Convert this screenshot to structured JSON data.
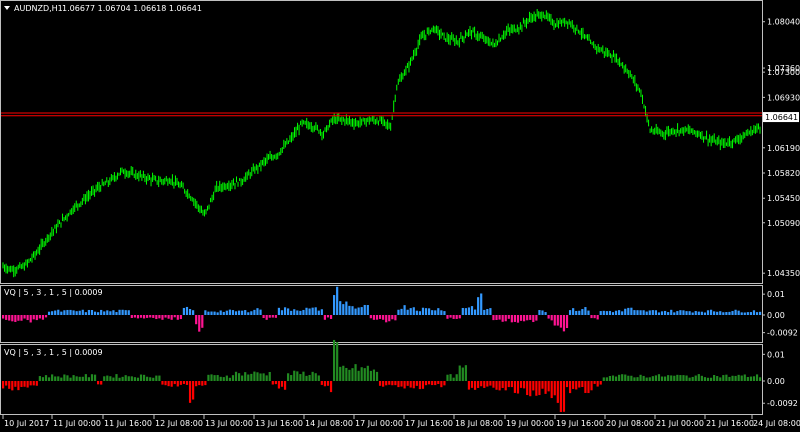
{
  "header": {
    "symbol_label": "AUDNZD,H1",
    "ohlc_text": "1.06677 1.06704 1.06618 1.06641"
  },
  "panels": {
    "indicator_1_label": "VQ | 5 , 3 , 1 , 5  |  0.0009",
    "indicator_2_label": "VQ | 5 , 3 , 1 , 5  |  0.0009"
  },
  "colors": {
    "bars": "#00ff00",
    "hline": "#ff0000",
    "ind1_up": "#3399ff",
    "ind1_down": "#ff1493",
    "ind2_up": "#228b22",
    "ind2_down": "#ff0000",
    "border": "#c0c0c0"
  },
  "chart_data": [
    {
      "type": "ohlc",
      "price_axis_ticks": [
        "1.08040",
        "1.07360",
        "1.07300",
        "1.06930",
        "1.06641",
        "1.06190",
        "1.05820",
        "1.05450",
        "1.05090",
        "1.04350"
      ],
      "ylim": [
        1.0425,
        1.083
      ],
      "current_price": 1.06641,
      "horizontal_lines": [
        1.067,
        1.0666
      ],
      "x_ticks": [
        "10 Jul 2017",
        "11 Jul 00:00",
        "11 Jul 16:00",
        "12 Jul 08:00",
        "13 Jul 00:00",
        "13 Jul 16:00",
        "14 Jul 08:00",
        "17 Jul 00:00",
        "17 Jul 16:00",
        "18 Jul 08:00",
        "19 Jul 00:00",
        "19 Jul 16:00",
        "20 Jul 08:00",
        "21 Jul 00:00",
        "21 Jul 16:00",
        "24 Jul 08:00"
      ],
      "close_path": [
        [
          0,
          1.0445
        ],
        [
          6,
          1.044
        ],
        [
          14,
          1.0445
        ],
        [
          22,
          1.0465
        ],
        [
          30,
          1.049
        ],
        [
          38,
          1.051
        ],
        [
          46,
          1.053
        ],
        [
          54,
          1.0545
        ],
        [
          62,
          1.056
        ],
        [
          70,
          1.057
        ],
        [
          78,
          1.0585
        ],
        [
          86,
          1.058
        ],
        [
          94,
          1.0575
        ],
        [
          102,
          1.057
        ],
        [
          110,
          1.0572
        ],
        [
          118,
          1.056
        ],
        [
          124,
          1.0545
        ],
        [
          132,
          1.052
        ],
        [
          140,
          1.056
        ],
        [
          148,
          1.0565
        ],
        [
          156,
          1.057
        ],
        [
          164,
          1.0585
        ],
        [
          172,
          1.06
        ],
        [
          180,
          1.061
        ],
        [
          188,
          1.063
        ],
        [
          196,
          1.0655
        ],
        [
          204,
          1.065
        ],
        [
          210,
          1.064
        ],
        [
          216,
          1.066
        ],
        [
          224,
          1.066
        ],
        [
          232,
          1.0655
        ],
        [
          240,
          1.066
        ],
        [
          248,
          1.0658
        ],
        [
          254,
          1.065
        ],
        [
          258,
          1.071
        ],
        [
          266,
          1.074
        ],
        [
          274,
          1.078
        ],
        [
          282,
          1.0795
        ],
        [
          290,
          1.078
        ],
        [
          298,
          1.0775
        ],
        [
          306,
          1.079
        ],
        [
          314,
          1.078
        ],
        [
          322,
          1.077
        ],
        [
          330,
          1.079
        ],
        [
          338,
          1.0795
        ],
        [
          346,
          1.081
        ],
        [
          354,
          1.0815
        ],
        [
          362,
          1.08
        ],
        [
          370,
          1.0805
        ],
        [
          378,
          1.079
        ],
        [
          386,
          1.077
        ],
        [
          394,
          1.076
        ],
        [
          402,
          1.075
        ],
        [
          410,
          1.073
        ],
        [
          418,
          1.07
        ],
        [
          424,
          1.0645
        ],
        [
          432,
          1.064
        ],
        [
          440,
          1.0645
        ],
        [
          448,
          1.0645
        ],
        [
          456,
          1.064
        ],
        [
          464,
          1.063
        ],
        [
          472,
          1.0625
        ],
        [
          480,
          1.063
        ],
        [
          488,
          1.064
        ],
        [
          496,
          1.065
        ]
      ],
      "indicator_1": {
        "ticks": [
          "0.01",
          "0.00",
          "-0.0092"
        ],
        "ylim": [
          -0.012,
          0.012
        ],
        "profile": [
          [
            0,
            -0.003
          ],
          [
            24,
            -0.002
          ],
          [
            30,
            0.002
          ],
          [
            70,
            0.002
          ],
          [
            84,
            -0.002
          ],
          [
            110,
            -0.002
          ],
          [
            118,
            0.003
          ],
          [
            124,
            0.002
          ],
          [
            126,
            -0.007
          ],
          [
            132,
            0.002
          ],
          [
            150,
            0.002
          ],
          [
            162,
            0.003
          ],
          [
            170,
            -0.002
          ],
          [
            180,
            0.003
          ],
          [
            198,
            0.003
          ],
          [
            210,
            -0.002
          ],
          [
            216,
            0.012
          ],
          [
            220,
            0.006
          ],
          [
            228,
            0.004
          ],
          [
            240,
            -0.002
          ],
          [
            250,
            -0.003
          ],
          [
            258,
            0.004
          ],
          [
            270,
            0.003
          ],
          [
            290,
            -0.002
          ],
          [
            300,
            0.004
          ],
          [
            310,
            0.008
          ],
          [
            314,
            0.003
          ],
          [
            320,
            -0.003
          ],
          [
            335,
            -0.004
          ],
          [
            350,
            0.002
          ],
          [
            355,
            -0.003
          ],
          [
            360,
            -0.006
          ],
          [
            362,
            -0.009
          ],
          [
            370,
            0.003
          ],
          [
            384,
            -0.002
          ],
          [
            390,
            0.002
          ],
          [
            406,
            0.003
          ],
          [
            412,
            0.002
          ]
        ]
      },
      "indicator_2": {
        "ticks": [
          "0.01",
          "0.00",
          "-0.0092"
        ],
        "ylim": [
          -0.012,
          0.012
        ],
        "profile": [
          [
            0,
            -0.003
          ],
          [
            20,
            -0.002
          ],
          [
            24,
            0.002
          ],
          [
            60,
            0.002
          ],
          [
            62,
            -0.002
          ],
          [
            66,
            0.002
          ],
          [
            90,
            0.002
          ],
          [
            104,
            -0.002
          ],
          [
            118,
            -0.002
          ],
          [
            122,
            -0.007
          ],
          [
            126,
            -0.002
          ],
          [
            134,
            0.002
          ],
          [
            150,
            0.003
          ],
          [
            170,
            0.003
          ],
          [
            176,
            -0.002
          ],
          [
            180,
            -0.003
          ],
          [
            186,
            0.003
          ],
          [
            198,
            0.003
          ],
          [
            208,
            -0.002
          ],
          [
            214,
            -0.004
          ],
          [
            216,
            0.012
          ],
          [
            220,
            0.005
          ],
          [
            240,
            0.004
          ],
          [
            246,
            -0.002
          ],
          [
            262,
            -0.003
          ],
          [
            275,
            -0.002
          ],
          [
            290,
            0.002
          ],
          [
            298,
            0.005
          ],
          [
            304,
            -0.003
          ],
          [
            320,
            -0.004
          ],
          [
            340,
            -0.005
          ],
          [
            355,
            -0.006
          ],
          [
            362,
            -0.01
          ],
          [
            368,
            -0.004
          ],
          [
            385,
            -0.002
          ],
          [
            392,
            0.002
          ],
          [
            410,
            0.002
          ]
        ]
      }
    }
  ]
}
